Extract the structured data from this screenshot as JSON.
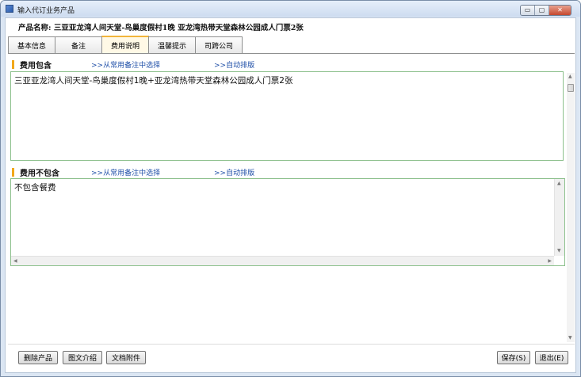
{
  "window": {
    "title": "输入代订业务产品",
    "controls": {
      "minimize": "▭",
      "maximize": "▢",
      "close": "✕"
    }
  },
  "product": {
    "label": "产品名称:",
    "name": "三亚亚龙湾人间天堂-鸟巢度假村1晚  亚龙湾热带天堂森林公园成人门票2张"
  },
  "tabs": [
    {
      "label": "基本信息",
      "active": false
    },
    {
      "label": "备注",
      "active": false
    },
    {
      "label": "费用说明",
      "active": true
    },
    {
      "label": "温馨提示",
      "active": false
    },
    {
      "label": "司跨公司",
      "active": false
    }
  ],
  "sections": {
    "included": {
      "title": "费用包含",
      "link_select": ">>从常用备注中选择",
      "link_auto": ">>自动排版",
      "value": "三亚亚龙湾人间天堂-鸟巢度假村1晚+亚龙湾热带天堂森林公园成人门票2张"
    },
    "excluded": {
      "title": "费用不包含",
      "link_select": ">>从常用备注中选择",
      "link_auto": ">>自动排版",
      "value": "不包含餐费"
    }
  },
  "footer": {
    "delete_label": "删除产品",
    "picture_label": "图文介绍",
    "attach_label": "文档附件",
    "save_label": "保存(S)",
    "exit_label": "退出(E)"
  },
  "icons": {
    "scroll_up": "▲",
    "scroll_down": "▼",
    "scroll_left": "◀",
    "scroll_right": "▶"
  },
  "colors": {
    "accent_marker": "#f2a81a",
    "link": "#2050a8",
    "textbox_border": "#8cc08c",
    "active_tab": "#fff9e6"
  }
}
